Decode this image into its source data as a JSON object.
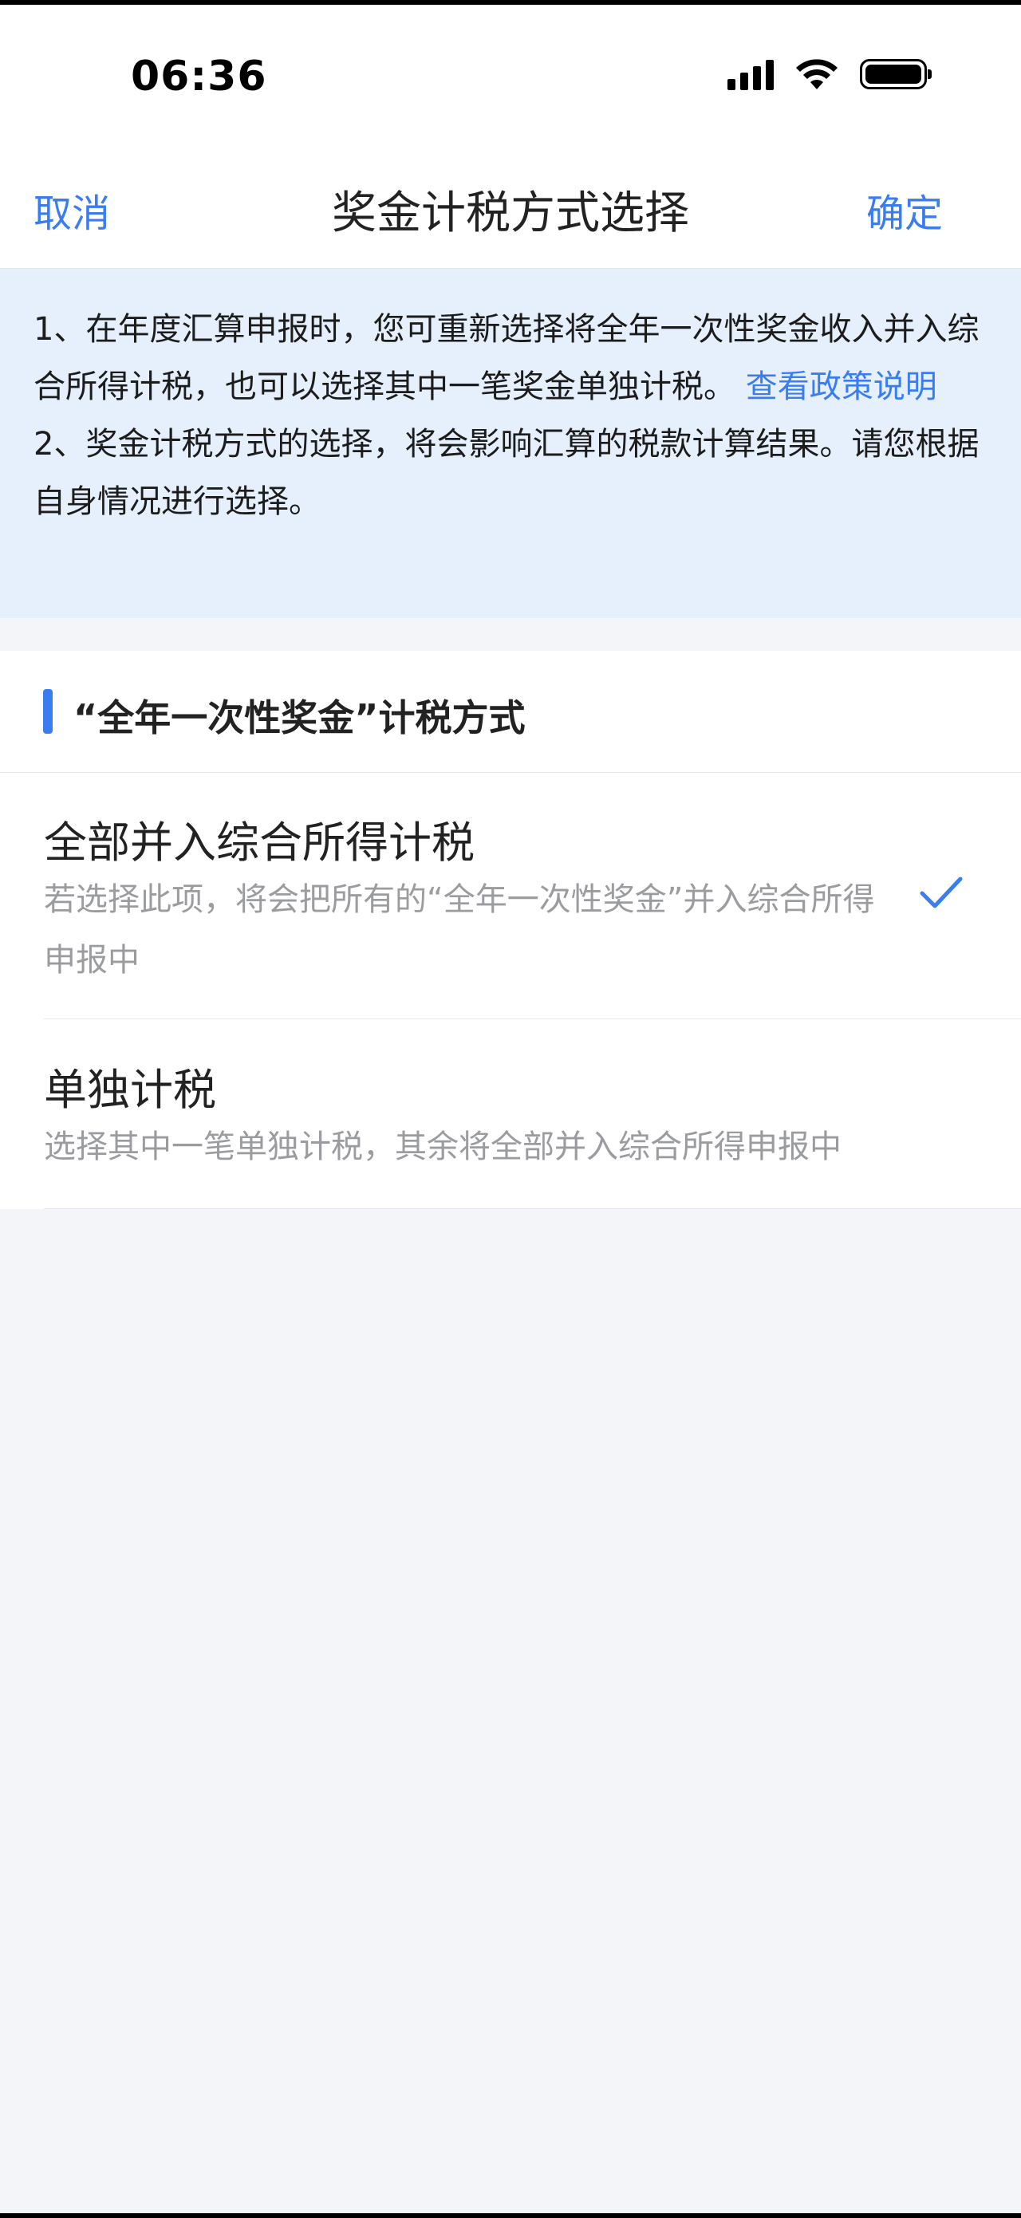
{
  "status_bar": {
    "time": "06:36"
  },
  "nav": {
    "cancel_label": "取消",
    "title": "奖金计税方式选择",
    "confirm_label": "确定"
  },
  "notice": {
    "line1_text": "1、在年度汇算申报时，您可重新选择将全年一次性奖金收入并入综合所得计税，也可以选择其中一笔奖金单独计税。",
    "link_text": "查看政策说明",
    "line2_text": "2、奖金计税方式的选择，将会影响汇算的税款计算结果。请您根据自身情况进行选择。"
  },
  "section": {
    "title": "“全年一次性奖金”计税方式"
  },
  "options": [
    {
      "title": "全部并入综合所得计税",
      "description": "若选择此项，将会把所有的“全年一次性奖金”并入综合所得申报中",
      "selected": true
    },
    {
      "title": "单独计税",
      "description": "选择其中一笔单独计税，其余将全部并入综合所得申报中",
      "selected": false
    }
  ],
  "colors": {
    "accent": "#3a7df0",
    "notice_bg": "#e6f0fc",
    "page_bg": "#f3f5f9",
    "muted_text": "#9a9ca0"
  },
  "icons": {
    "selected": "checkmark-icon"
  }
}
